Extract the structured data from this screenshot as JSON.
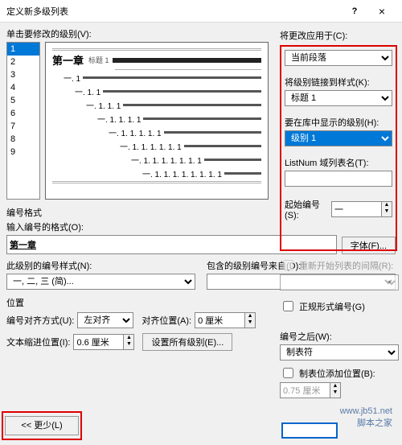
{
  "window": {
    "title": "定义新多级列表",
    "help": "?",
    "close": "×"
  },
  "click_label": "单击要修改的级别(V):",
  "levels": [
    "1",
    "2",
    "3",
    "4",
    "5",
    "6",
    "7",
    "8",
    "9"
  ],
  "preview": {
    "l1": "第一章",
    "l1sub": "标题 1",
    "l2": "一. 1",
    "l3": "一. 1. 1",
    "l4": "一. 1. 1. 1",
    "l5": "一. 1. 1. 1. 1",
    "l6": "一. 1. 1. 1. 1. 1",
    "l7": "一. 1. 1. 1. 1. 1. 1",
    "l8": "一. 1. 1. 1. 1. 1. 1. 1",
    "l9": "一. 1. 1. 1. 1. 1. 1. 1. 1"
  },
  "right": {
    "apply_to_lbl": "将更改应用于(C):",
    "apply_to_val": "当前段落",
    "link_style_lbl": "将级别链接到样式(K):",
    "link_style_val": "标题 1",
    "show_in_gallery_lbl": "要在库中显示的级别(H):",
    "show_in_gallery_val": "级别 1",
    "listnum_lbl": "ListNum 域列表名(T):",
    "listnum_val": "",
    "start_at_lbl": "起始编号(S):",
    "start_at_val": "一",
    "restart_lbl": "重新开始列表的间隔(R):",
    "legal_lbl": "正规形式编号(G)",
    "follow_lbl": "编号之后(W):",
    "follow_val": "制表符",
    "tab_add_lbl": "制表位添加位置(B):",
    "tab_add_val": "0.75 厘米"
  },
  "numfmt": {
    "section": "编号格式",
    "enter_lbl": "输入编号的格式(O):",
    "enter_val": "第一章",
    "font_btn": "字体(F)...",
    "style_lbl": "此级别的编号样式(N):",
    "style_val": "一, 二, 三 (简)...",
    "include_lbl": "包含的级别编号来自(D):",
    "include_val": ""
  },
  "pos": {
    "section": "位置",
    "align_lbl": "编号对齐方式(U):",
    "align_val": "左对齐",
    "align_at_lbl": "对齐位置(A):",
    "align_at_val": "0 厘米",
    "indent_lbl": "文本缩进位置(I):",
    "indent_val": "0.6 厘米",
    "set_all_btn": "设置所有级别(E)..."
  },
  "less_btn": "<< 更少(L)",
  "watermark": "www.jb51.net\n脚本之家"
}
